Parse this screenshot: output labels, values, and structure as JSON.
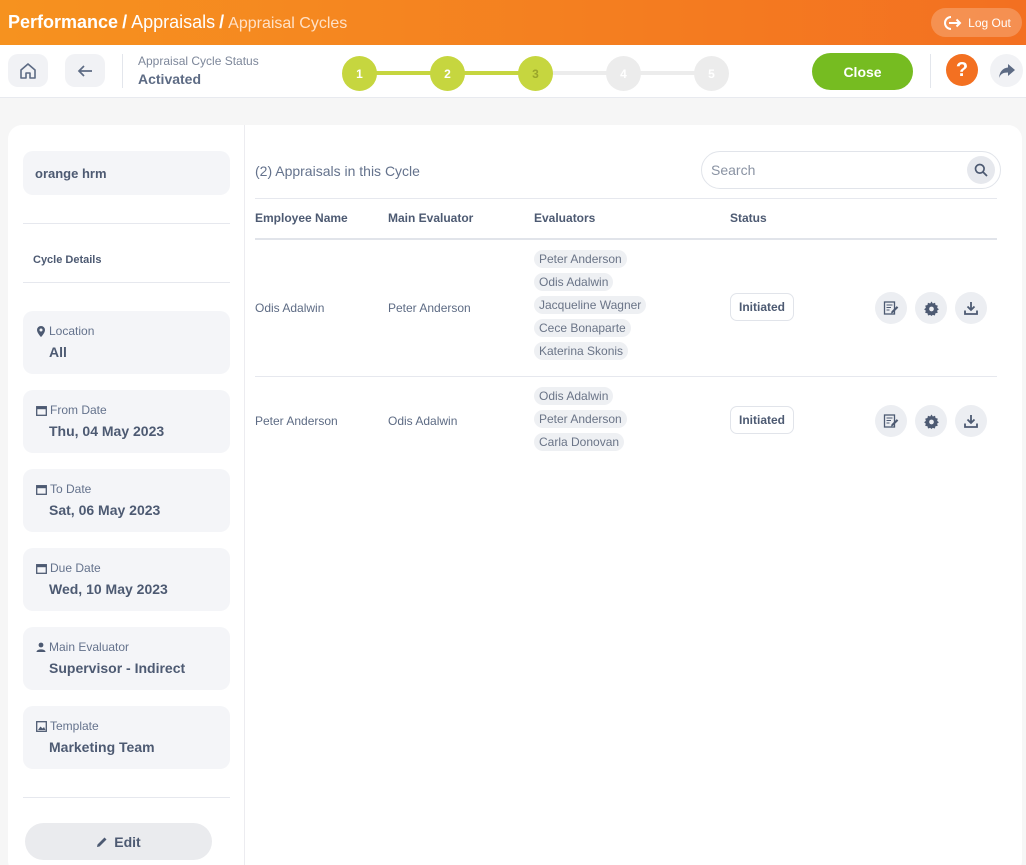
{
  "header": {
    "crumb_module": "Performance",
    "crumb_section": "Appraisals",
    "crumb_page": "Appraisal Cycles",
    "separator": "/",
    "logout_label": "Log Out"
  },
  "subheader": {
    "status_label": "Appraisal Cycle Status",
    "status_value": "Activated",
    "steps": [
      "1",
      "2",
      "3",
      "4",
      "5"
    ],
    "active_steps_completed": 3,
    "close_label": "Close",
    "help_label": "?"
  },
  "sidebar": {
    "org_name": "orange hrm",
    "cycle_details_title": "Cycle Details",
    "details": [
      {
        "label": "Location",
        "value": "All",
        "icon": "map-pin-icon"
      },
      {
        "label": "From Date",
        "value": "Thu, 04 May 2023",
        "icon": "calendar-icon"
      },
      {
        "label": "To Date",
        "value": "Sat, 06 May 2023",
        "icon": "calendar-icon"
      },
      {
        "label": "Due Date",
        "value": "Wed, 10 May 2023",
        "icon": "calendar-icon"
      },
      {
        "label": "Main Evaluator",
        "value": "Supervisor - Indirect",
        "icon": "person-icon"
      },
      {
        "label": "Template",
        "value": "Marketing Team",
        "icon": "image-icon"
      }
    ],
    "edit_label": "Edit"
  },
  "main": {
    "heading": "(2) Appraisals in this Cycle",
    "search_placeholder": "Search",
    "columns": [
      "Employee Name",
      "Main Evaluator",
      "Evaluators",
      "Status"
    ],
    "rows": [
      {
        "employee": "Odis Adalwin",
        "main_evaluator": "Peter Anderson",
        "evaluators": [
          "Peter Anderson",
          "Odis Adalwin",
          "Jacqueline Wagner",
          "Cece Bonaparte",
          "Katerina Skonis"
        ],
        "status": "Initiated"
      },
      {
        "employee": "Peter Anderson",
        "main_evaluator": "Odis Adalwin",
        "evaluators": [
          "Odis Adalwin",
          "Peter Anderson",
          "Carla Donovan"
        ],
        "status": "Initiated"
      }
    ]
  },
  "colors": {
    "brand_orange": "#f37021",
    "step_done": "#c6d63f",
    "step_pending": "#ececec",
    "close_green": "#76bc21"
  }
}
